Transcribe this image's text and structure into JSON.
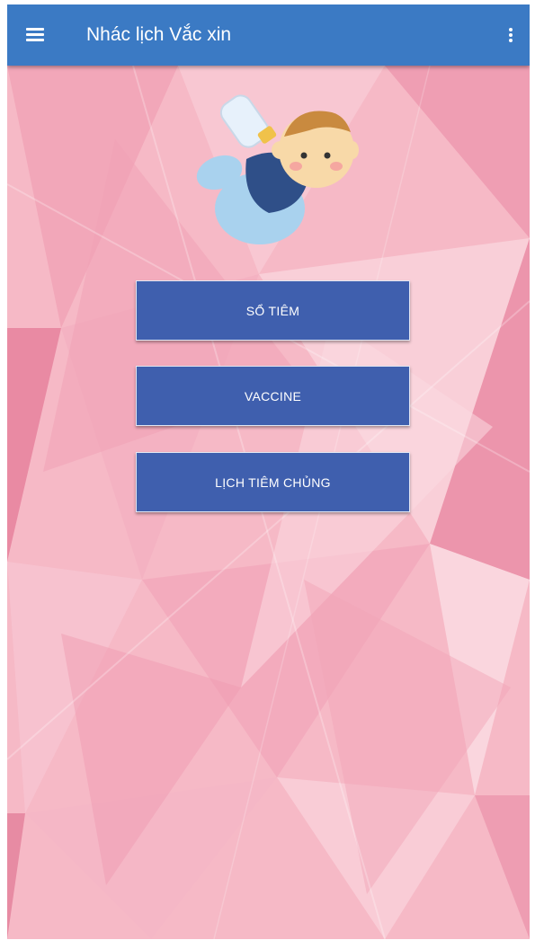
{
  "app_bar": {
    "title": "Nhác lịch Vắc xin",
    "menu_icon": "hamburger-menu-icon",
    "overflow_icon": "more-vert-icon",
    "color": "#3b7ac4"
  },
  "illustration": "baby-with-bottle",
  "buttons": [
    {
      "label": "SỔ TIÊM"
    },
    {
      "label": "VACCINE"
    },
    {
      "label": "LỊCH TIÊM CHỦNG"
    }
  ],
  "colors": {
    "button_bg": "#3f5fae",
    "background": "#f6b9c6"
  }
}
